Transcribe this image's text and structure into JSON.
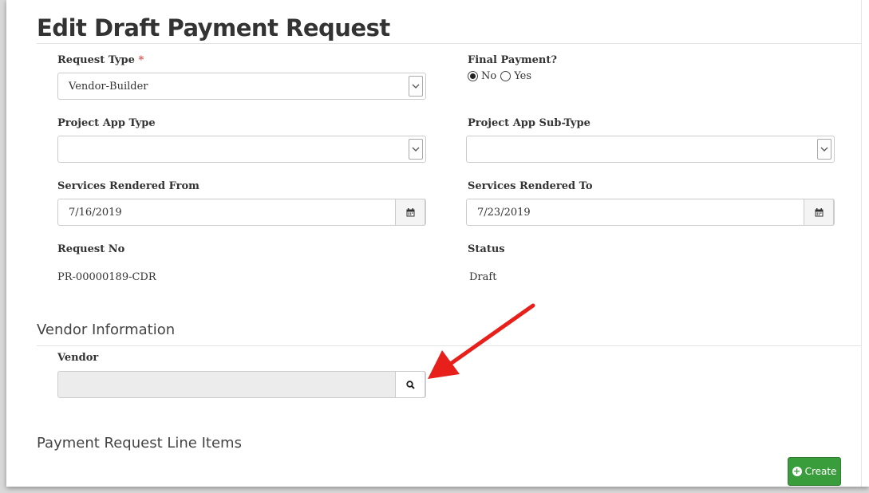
{
  "page": {
    "title": "Edit Draft Payment Request"
  },
  "form": {
    "request_type": {
      "label": "Request Type",
      "required_mark": "*",
      "value": "Vendor-Builder"
    },
    "final_payment": {
      "label": "Final Payment?",
      "options": [
        "No",
        "Yes"
      ],
      "selected": "No"
    },
    "project_app_type": {
      "label": "Project App Type",
      "value": ""
    },
    "project_app_sub_type": {
      "label": "Project App Sub-Type",
      "value": ""
    },
    "services_from": {
      "label": "Services Rendered From",
      "value": "7/16/2019"
    },
    "services_to": {
      "label": "Services Rendered To",
      "value": "7/23/2019"
    },
    "request_no": {
      "label": "Request No",
      "value": "PR-00000189-CDR"
    },
    "status": {
      "label": "Status",
      "value": "Draft"
    }
  },
  "vendor_section": {
    "heading": "Vendor Information",
    "vendor_label": "Vendor",
    "vendor_value": ""
  },
  "line_items_section": {
    "heading": "Payment Request Line Items",
    "create_label": "Create"
  },
  "colors": {
    "required": "#d9534f",
    "create_button": "#3a9d3c",
    "arrow": "#e8201c"
  },
  "icons": {
    "calendar": "calendar-icon",
    "search": "search-icon",
    "plus": "plus-circle-icon",
    "caret": "chevron-down-icon"
  }
}
